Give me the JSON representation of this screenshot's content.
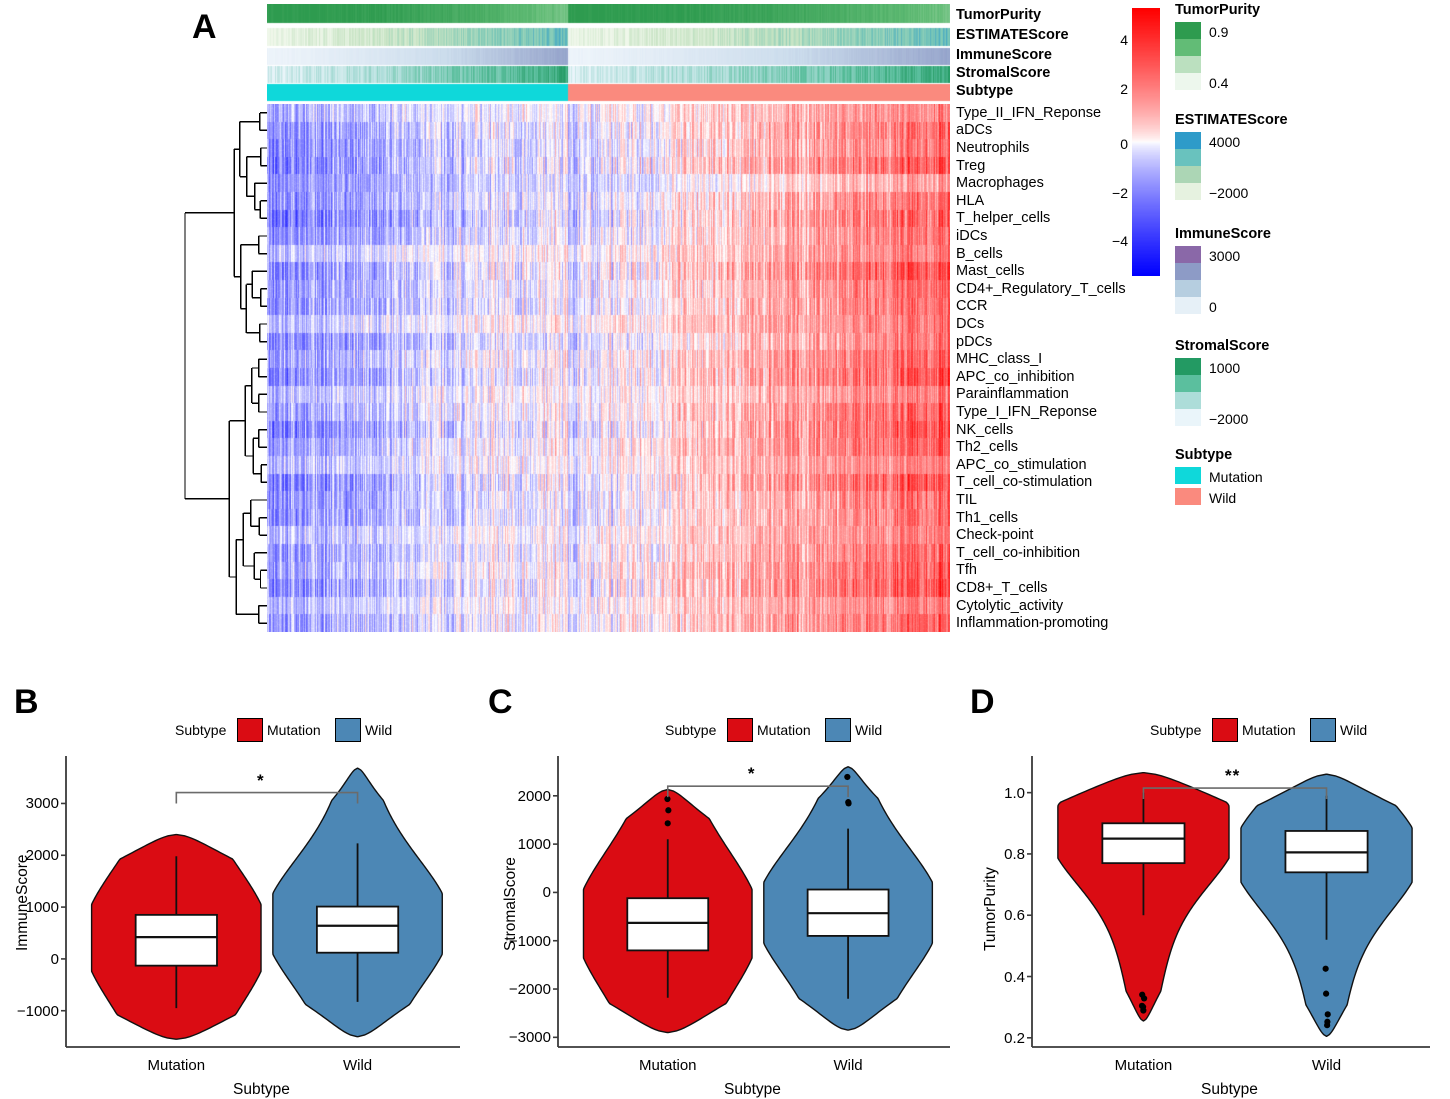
{
  "figure": {
    "panels": [
      "A",
      "B",
      "C",
      "D"
    ]
  },
  "panelA": {
    "letter": "A",
    "annotation_rows": [
      {
        "name": "TumorPurity",
        "palette": "green"
      },
      {
        "name": "ESTIMATEScore",
        "palette": "teal-blue"
      },
      {
        "name": "ImmuneScore",
        "palette": "purple-blue"
      },
      {
        "name": "StromalScore",
        "palette": "green-teal"
      },
      {
        "name": "Subtype",
        "palette": "categorical"
      }
    ],
    "row_labels": [
      "Type_II_IFN_Reponse",
      "aDCs",
      "Neutrophils",
      "Treg",
      "Macrophages",
      "HLA",
      "T_helper_cells",
      "iDCs",
      "B_cells",
      "Mast_cells",
      "CD4+_Regulatory_T_cells",
      "CCR",
      "DCs",
      "pDCs",
      "MHC_class_I",
      "APC_co_inhibition",
      "Parainflammation",
      "Type_I_IFN_Reponse",
      "NK_cells",
      "Th2_cells",
      "APC_co_stimulation",
      "T_cell_co-stimulation",
      "TIL",
      "Th1_cells",
      "Check-point",
      "T_cell_co-inhibition",
      "Tfh",
      "CD8+_T_cells",
      "Cytolytic_activity",
      "Inflammation-promoting"
    ],
    "colorbar": {
      "ticks": [
        "4",
        "2",
        "0",
        "-2",
        "-4"
      ],
      "high_color": "#0000FF",
      "low_color": "#FF0000",
      "mid_color": "#FFFFFF"
    },
    "legends": [
      {
        "title": "TumorPurity",
        "type": "gradient",
        "max_label": "0.9",
        "min_label": "0.4",
        "colors": [
          "#2E9B4F",
          "#62BC76",
          "#BBE0BF",
          "#EDF7ED"
        ]
      },
      {
        "title": "ESTIMATEScore",
        "type": "gradient",
        "max_label": "4000",
        "min_label": "-2000",
        "colors": [
          "#2E9BC9",
          "#69C2BE",
          "#ACD6B5",
          "#E6F2E0"
        ]
      },
      {
        "title": "ImmuneScore",
        "type": "gradient",
        "max_label": "3000",
        "min_label": "0",
        "colors": [
          "#8A68A8",
          "#8D9BC6",
          "#B6CEE0",
          "#E6F0F7"
        ]
      },
      {
        "title": "StromalScore",
        "type": "gradient",
        "max_label": "1000",
        "min_label": "-2000",
        "colors": [
          "#239A63",
          "#5BBF9E",
          "#ADDDD9",
          "#EAF5FA"
        ]
      },
      {
        "title": "Subtype",
        "type": "categorical",
        "items": [
          {
            "label": "Mutation",
            "color": "#0FD8DA"
          },
          {
            "label": "Wild",
            "color": "#FA8A7E"
          }
        ]
      }
    ]
  },
  "chart_data": [
    {
      "panel": "A",
      "type": "heatmap",
      "title": "",
      "ylabel": "",
      "xlabel": "",
      "rows": [
        "Type_II_IFN_Reponse",
        "aDCs",
        "Neutrophils",
        "Treg",
        "Macrophages",
        "HLA",
        "T_helper_cells",
        "iDCs",
        "B_cells",
        "Mast_cells",
        "CD4+_Regulatory_T_cells",
        "CCR",
        "DCs",
        "pDCs",
        "MHC_class_I",
        "APC_co_inhibition",
        "Parainflammation",
        "Type_I_IFN_Reponse",
        "NK_cells",
        "Th2_cells",
        "APC_co_stimulation",
        "T_cell_co-stimulation",
        "TIL",
        "Th1_cells",
        "Check-point",
        "T_cell_co-inhibition",
        "Tfh",
        "CD8+_T_cells",
        "Cytolytic_activity",
        "Inflammation-promoting"
      ],
      "column_groups": [
        {
          "label": "Mutation",
          "fraction": 0.44,
          "color": "#0FD8DA"
        },
        {
          "label": "Wild",
          "fraction": 0.56,
          "color": "#FA8A7E"
        }
      ],
      "zlim": [
        -5,
        5
      ],
      "colorbar_ticks": [
        4,
        2,
        0,
        -2,
        -4
      ],
      "row_dendrogram": true,
      "note": "z-scored ssGSEA immune-signature scores; Mutation block skews blue/low, Wild block skews red/high"
    },
    {
      "panel": "B",
      "type": "violin",
      "title": "",
      "xlabel": "Subtype",
      "ylabel": "ImmuneScore",
      "ylim": [
        -1700,
        3800
      ],
      "yticks": [
        -1000,
        0,
        1000,
        2000,
        3000
      ],
      "categories": [
        "Mutation",
        "Wild"
      ],
      "legend_title": "Subtype",
      "legend_position": "top",
      "significance": "*",
      "series": [
        {
          "name": "Mutation",
          "color": "#DA0C13",
          "q1": -130,
          "median": 420,
          "q3": 850,
          "whisker_low": -950,
          "whisker_high": 1980,
          "violin_min": -1550,
          "violin_max": 2400,
          "width_peak_at": 430
        },
        {
          "name": "Wild",
          "color": "#4C87B5",
          "q1": 120,
          "median": 640,
          "q3": 1010,
          "whisker_low": -830,
          "whisker_high": 2230,
          "violin_min": -1500,
          "violin_max": 3680,
          "width_peak_at": 700
        }
      ]
    },
    {
      "panel": "C",
      "type": "violin",
      "title": "",
      "xlabel": "Subtype",
      "ylabel": "StromalScore",
      "ylim": [
        -3200,
        2700
      ],
      "yticks": [
        -3000,
        -2000,
        -1000,
        0,
        1000,
        2000
      ],
      "categories": [
        "Mutation",
        "Wild"
      ],
      "legend_title": "Subtype",
      "legend_position": "top",
      "significance": "*",
      "series": [
        {
          "name": "Mutation",
          "color": "#DA0C13",
          "q1": -1200,
          "median": -630,
          "q3": -120,
          "whisker_low": -2180,
          "whisker_high": 1100,
          "violin_min": -2900,
          "violin_max": 2130,
          "width_peak_at": -620
        },
        {
          "name": "Wild",
          "color": "#4C87B5",
          "q1": -900,
          "median": -430,
          "q3": 60,
          "whisker_low": -2200,
          "whisker_high": 1320,
          "violin_min": -2850,
          "violin_max": 2600,
          "width_peak_at": -400
        }
      ]
    },
    {
      "panel": "D",
      "type": "violin",
      "title": "",
      "xlabel": "Subtype",
      "ylabel": "TumorPurity",
      "ylim": [
        0.17,
        1.1
      ],
      "yticks": [
        0.2,
        0.4,
        0.6,
        0.8,
        1.0
      ],
      "categories": [
        "Mutation",
        "Wild"
      ],
      "legend_title": "Subtype",
      "legend_position": "top",
      "significance": "**",
      "series": [
        {
          "name": "Mutation",
          "color": "#DA0C13",
          "q1": 0.77,
          "median": 0.85,
          "q3": 0.9,
          "whisker_low": 0.6,
          "whisker_high": 1.0,
          "violin_min": 0.255,
          "violin_max": 1.065,
          "width_peak_at": 0.875
        },
        {
          "name": "Wild",
          "color": "#4C87B5",
          "q1": 0.74,
          "median": 0.805,
          "q3": 0.875,
          "whisker_low": 0.52,
          "whisker_high": 0.99,
          "violin_min": 0.205,
          "violin_max": 1.06,
          "width_peak_at": 0.8
        }
      ]
    }
  ],
  "panelB": {
    "letter": "B"
  },
  "panelC": {
    "letter": "C"
  },
  "panelD": {
    "letter": "D"
  },
  "violin_legend": {
    "title": "Subtype",
    "items": [
      {
        "label": "Mutation",
        "color": "#DA0C13"
      },
      {
        "label": "Wild",
        "color": "#4C87B5"
      }
    ]
  }
}
